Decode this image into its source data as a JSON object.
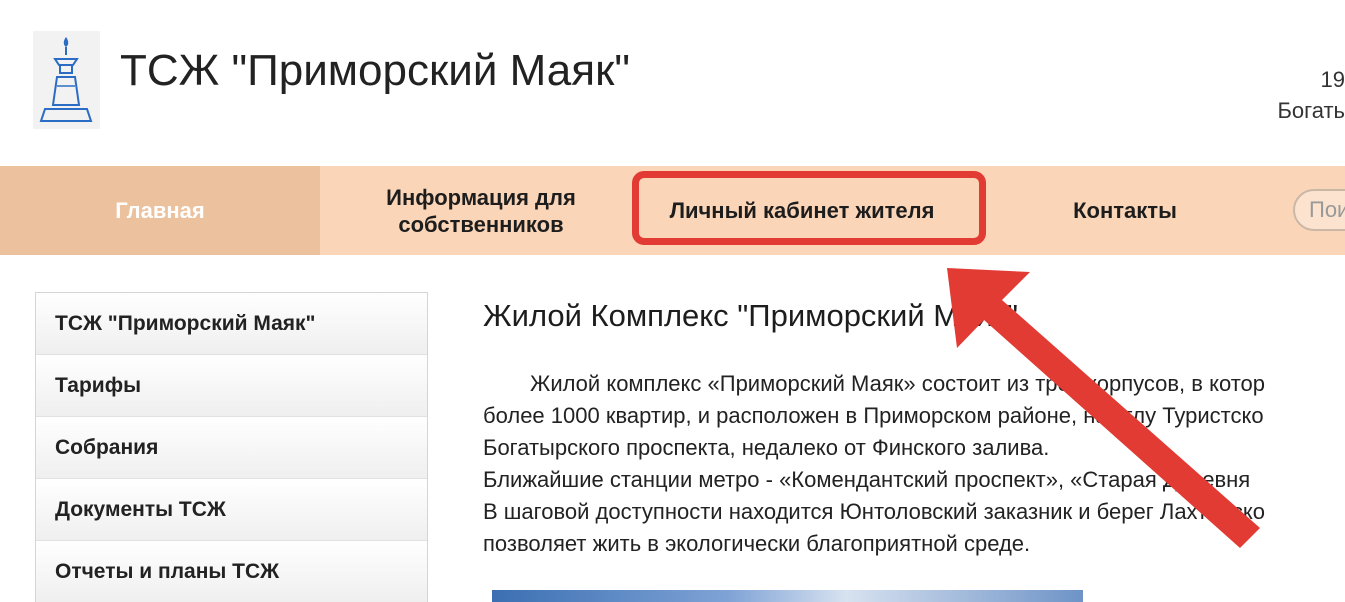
{
  "header": {
    "title": "ТСЖ \"Приморский Маяк\"",
    "right_line1": "19",
    "right_line2": "Богать"
  },
  "nav": {
    "items": [
      {
        "label": "Главная"
      },
      {
        "label": "Информация для собственников"
      },
      {
        "label": "Личный кабинет жителя"
      },
      {
        "label": "Контакты"
      }
    ],
    "search_placeholder": "Пои"
  },
  "sidebar": {
    "items": [
      {
        "label": "ТСЖ \"Приморский Маяк\""
      },
      {
        "label": "Тарифы"
      },
      {
        "label": "Собрания"
      },
      {
        "label": "Документы ТСЖ"
      },
      {
        "label": "Отчеты и планы ТСЖ"
      }
    ]
  },
  "content": {
    "title": "Жилой Комплекс \"Приморский Маяк\"",
    "lines": [
      "Жилой комплекс «Приморский Маяк» состоит из трёх корпусов, в котор",
      "более 1000 квартир, и расположен в Приморском районе, на углу Туристско",
      "Богатырского проспекта, недалеко от Финского залива.",
      "Ближайшие станции  метро - «Комендантский проспект», «Старая  Деревня",
      "В шаговой доступности находится Юнтоловский заказник и берег Лахтинско",
      "позволяет жить в экологически благоприятной среде."
    ]
  },
  "colors": {
    "nav_bg": "#fbd5b7",
    "nav_active_bg": "#ecc19e",
    "highlight": "#e23b33"
  }
}
